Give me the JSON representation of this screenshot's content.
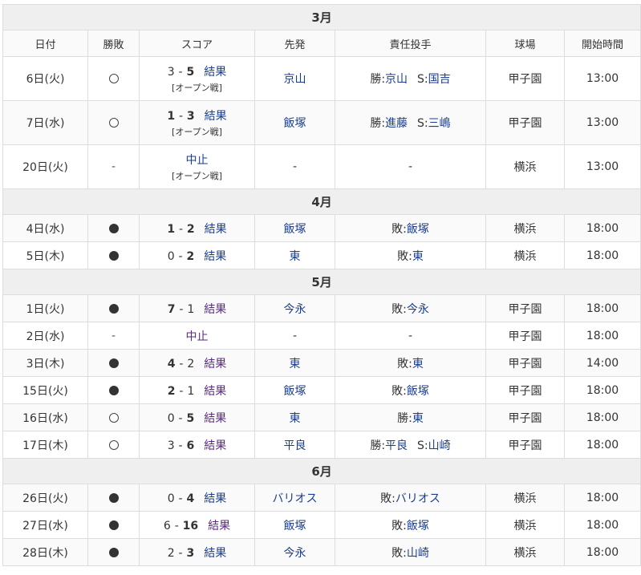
{
  "headers": [
    "日付",
    "勝敗",
    "スコア",
    "先発",
    "責任投手",
    "球場",
    "開始時間"
  ],
  "months": [
    {
      "label": "3月",
      "games": [
        {
          "date": "6日(火)",
          "mark": "win",
          "score_a": "3",
          "sep": "-",
          "score_b": "5",
          "bold": "b",
          "result": "結果",
          "result_visited": false,
          "note": "[オープン戦]",
          "starter": "京山",
          "pitcher_label": "勝:",
          "pitcher": "京山",
          "save_label": "S:",
          "save": "国吉",
          "stadium": "甲子園",
          "time": "13:00"
        },
        {
          "date": "7日(水)",
          "mark": "win",
          "score_a": "1",
          "sep": "-",
          "score_b": "3",
          "bold": "both",
          "result": "結果",
          "result_visited": false,
          "note": "[オープン戦]",
          "starter": "飯塚",
          "pitcher_label": "勝:",
          "pitcher": "進藤",
          "save_label": "S:",
          "save": "三嶋",
          "stadium": "甲子園",
          "time": "13:00"
        },
        {
          "date": "20日(火)",
          "mark": "none",
          "stopped": "中止",
          "stopped_visited": false,
          "note": "[オープン戦]",
          "starter_dash": "-",
          "pitcher_dash": "-",
          "stadium": "横浜",
          "time": "13:00"
        }
      ]
    },
    {
      "label": "4月",
      "games": [
        {
          "date": "4日(水)",
          "mark": "loss",
          "score_a": "1",
          "sep": "-",
          "score_b": "2",
          "bold": "both",
          "result": "結果",
          "result_visited": false,
          "starter": "飯塚",
          "pitcher_label": "敗:",
          "pitcher": "飯塚",
          "stadium": "横浜",
          "time": "18:00"
        },
        {
          "date": "5日(木)",
          "mark": "loss",
          "score_a": "0",
          "sep": "-",
          "score_b": "2",
          "bold": "b",
          "result": "結果",
          "result_visited": false,
          "starter": "東",
          "pitcher_label": "敗:",
          "pitcher": "東",
          "stadium": "横浜",
          "time": "18:00"
        }
      ]
    },
    {
      "label": "5月",
      "games": [
        {
          "date": "1日(火)",
          "mark": "loss",
          "score_a": "7",
          "sep": "-",
          "score_b": "1",
          "bold": "a",
          "result": "結果",
          "result_visited": true,
          "starter": "今永",
          "pitcher_label": "敗:",
          "pitcher": "今永",
          "stadium": "甲子園",
          "time": "18:00"
        },
        {
          "date": "2日(水)",
          "mark": "none",
          "stopped": "中止",
          "stopped_visited": true,
          "starter_dash": "-",
          "pitcher_dash": "-",
          "stadium": "甲子園",
          "time": "18:00"
        },
        {
          "date": "3日(木)",
          "mark": "loss",
          "score_a": "4",
          "sep": "-",
          "score_b": "2",
          "bold": "a",
          "result": "結果",
          "result_visited": true,
          "starter": "東",
          "pitcher_label": "敗:",
          "pitcher": "東",
          "stadium": "甲子園",
          "time": "14:00"
        },
        {
          "date": "15日(火)",
          "mark": "loss",
          "score_a": "2",
          "sep": "-",
          "score_b": "1",
          "bold": "a",
          "result": "結果",
          "result_visited": true,
          "starter": "飯塚",
          "pitcher_label": "敗:",
          "pitcher": "飯塚",
          "stadium": "甲子園",
          "time": "18:00"
        },
        {
          "date": "16日(水)",
          "mark": "win",
          "score_a": "0",
          "sep": "-",
          "score_b": "5",
          "bold": "b",
          "result": "結果",
          "result_visited": true,
          "starter": "東",
          "pitcher_label": "勝:",
          "pitcher": "東",
          "stadium": "甲子園",
          "time": "18:00"
        },
        {
          "date": "17日(木)",
          "mark": "win",
          "score_a": "3",
          "sep": "-",
          "score_b": "6",
          "bold": "b",
          "result": "結果",
          "result_visited": true,
          "starter": "平良",
          "pitcher_label": "勝:",
          "pitcher": "平良",
          "save_label": "S:",
          "save": "山崎",
          "stadium": "甲子園",
          "time": "18:00"
        }
      ]
    },
    {
      "label": "6月",
      "games": [
        {
          "date": "26日(火)",
          "mark": "loss",
          "score_a": "0",
          "sep": "-",
          "score_b": "4",
          "bold": "b",
          "result": "結果",
          "result_visited": false,
          "starter": "バリオス",
          "pitcher_label": "敗:",
          "pitcher": "バリオス",
          "stadium": "横浜",
          "time": "18:00"
        },
        {
          "date": "27日(水)",
          "mark": "loss",
          "score_a": "6",
          "sep": "-",
          "score_b": "16",
          "bold": "b",
          "result": "結果",
          "result_visited": true,
          "starter": "飯塚",
          "pitcher_label": "敗:",
          "pitcher": "飯塚",
          "stadium": "横浜",
          "time": "18:00"
        },
        {
          "date": "28日(木)",
          "mark": "loss",
          "score_a": "2",
          "sep": "-",
          "score_b": "3",
          "bold": "b",
          "result": "結果",
          "result_visited": false,
          "starter": "今永",
          "pitcher_label": "敗:",
          "pitcher": "山崎",
          "stadium": "横浜",
          "time": "18:00"
        }
      ]
    }
  ],
  "colors": {
    "link": "#1a3d8f",
    "visited": "#5a2a82",
    "month_bg": "#efefef",
    "border": "#dddddd"
  }
}
